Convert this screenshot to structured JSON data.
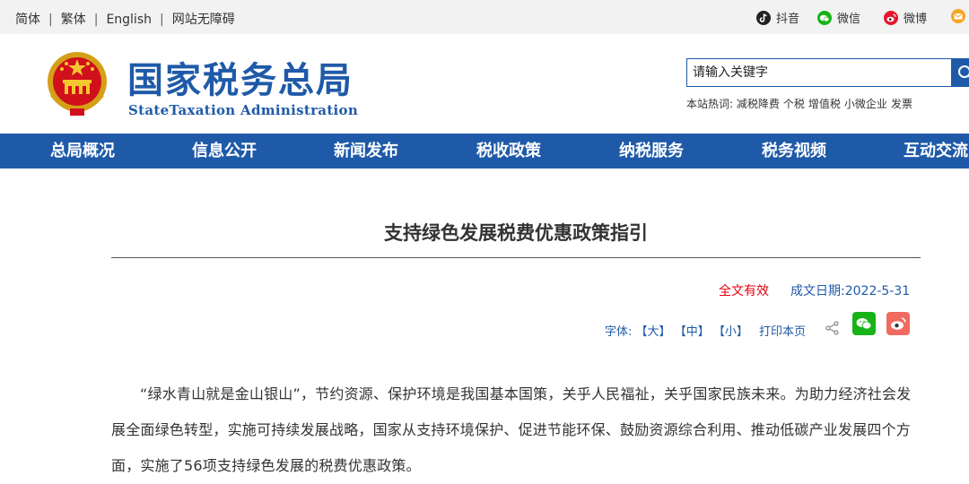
{
  "topbar": {
    "links": [
      "简体",
      "繁体",
      "English",
      "网站无障碍"
    ],
    "separator": "|",
    "social": [
      {
        "label": "抖音",
        "icon": "douyin-icon",
        "color": "#222222"
      },
      {
        "label": "微信",
        "icon": "wechat-icon",
        "color": "#17b317"
      },
      {
        "label": "微博",
        "icon": "weibo-icon",
        "color": "#e6162d"
      },
      {
        "label": "",
        "icon": "mail-icon",
        "color": "#f5a623"
      }
    ]
  },
  "header": {
    "logo_cn": "国家税务总局",
    "logo_en": "StateTaxation Administration",
    "brand_color": "#1f5aa8"
  },
  "search": {
    "placeholder": "请输入关键字",
    "hot_label": "本站热词:",
    "hot_words": [
      "减税降费",
      "个税",
      "增值税",
      "小微企业",
      "发票"
    ]
  },
  "nav": {
    "items": [
      "总局概况",
      "信息公开",
      "新闻发布",
      "税收政策",
      "纳税服务",
      "税务视频",
      "互动交流"
    ]
  },
  "article": {
    "title": "支持绿色发展税费优惠政策指引",
    "validity": "全文有效",
    "validity_color": "#e60012",
    "date_label": "成文日期:2022-5-31",
    "font_label": "字体:",
    "font_large": "【大】",
    "font_medium": "【中】",
    "font_small": "【小】",
    "print_label": "打印本页",
    "paragraph": "“绿水青山就是金山银山”，节约资源、保护环境是我国基本国策，关乎人民福祉，关乎国家民族未来。为助力经济社会发展全面绿色转型，实施可持续发展战略，国家从支持环境保护、促进节能环保、鼓励资源综合利用、推动低碳产业发展四个方面，实施了56项支持绿色发展的税费优惠政策。"
  }
}
